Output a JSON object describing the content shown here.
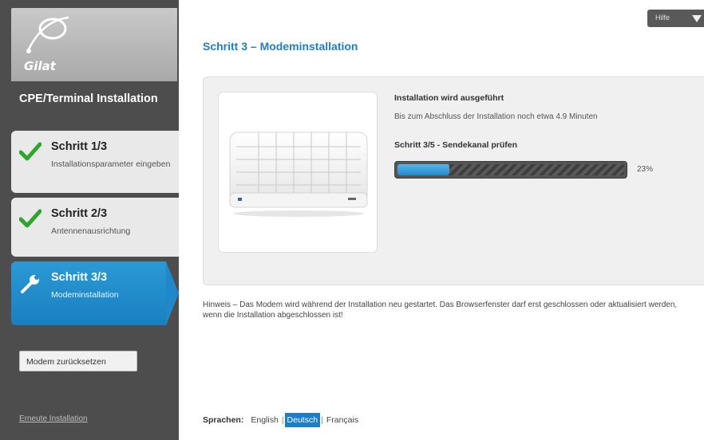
{
  "brand": {
    "logo_text": "Gilat"
  },
  "sidebar": {
    "title": "CPE/Terminal Installation",
    "steps": [
      {
        "title": "Schritt 1/3",
        "description": "Installationsparameter eingeben",
        "state": "done",
        "icon": "checkmark-icon"
      },
      {
        "title": "Schritt 2/3",
        "description": "Antennenausrichtung",
        "state": "done",
        "icon": "checkmark-icon"
      },
      {
        "title": "Schritt 3/3",
        "description": "Modeminstallation",
        "state": "active",
        "icon": "wrench-icon"
      }
    ],
    "reset_button": "Modem zurücksetzen",
    "reinstall_link": "Erneute Installation"
  },
  "help": {
    "label": "Hilfe",
    "icon": "triangle-down-icon"
  },
  "main": {
    "title": "Schritt 3 – Modeminstallation",
    "status_title": "Installation wird ausgeführt",
    "status_subtitle": "Bis zum Abschluss der Installation noch etwa 4.9 Minuten",
    "current_step": "Schritt 3/5 - Sendekanal prüfen",
    "progress": {
      "percent": 23,
      "label": "23%"
    },
    "note": "Hinweis – Das Modem wird während der Installation neu gestartet. Das Browserfenster darf erst geschlossen oder aktualisiert werden, wenn die Installation abgeschlossen ist!"
  },
  "languages": {
    "label": "Sprachen:",
    "options": [
      "English",
      "Deutsch",
      "Français"
    ],
    "selected": "Deutsch"
  },
  "colors": {
    "accent": "#1f7fc3",
    "sidebar_bg": "#4d4d4d",
    "check_green": "#2ea52e"
  }
}
